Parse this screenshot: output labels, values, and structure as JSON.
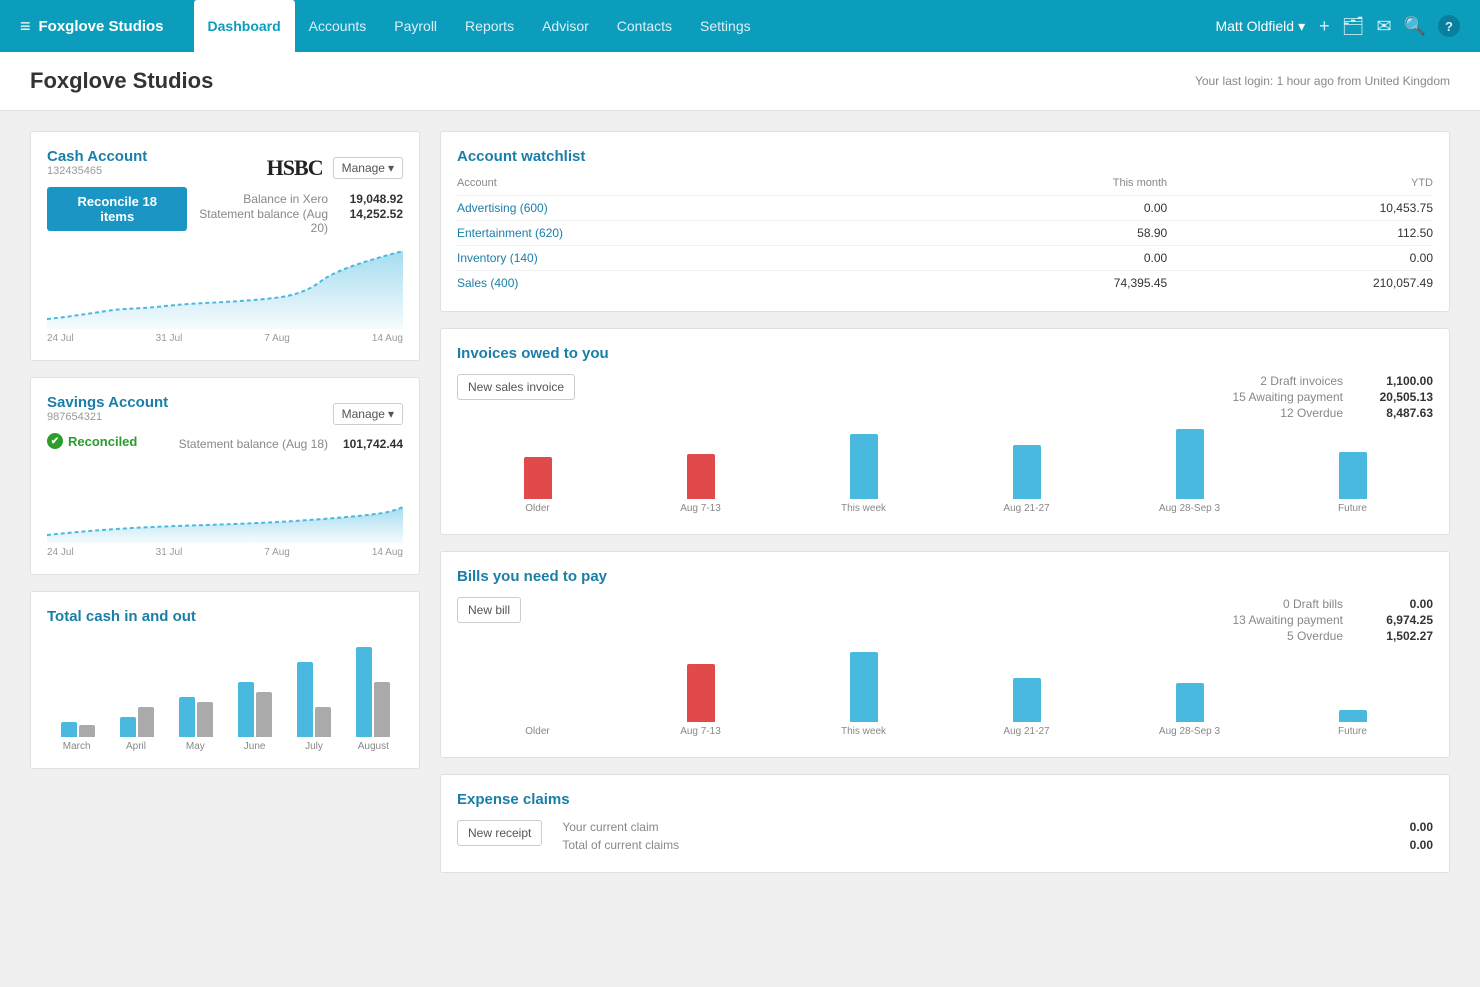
{
  "brand": {
    "icon": "≡",
    "name": "Foxglove Studios"
  },
  "nav": {
    "links": [
      {
        "label": "Dashboard",
        "active": true
      },
      {
        "label": "Accounts",
        "active": false
      },
      {
        "label": "Payroll",
        "active": false
      },
      {
        "label": "Reports",
        "active": false
      },
      {
        "label": "Advisor",
        "active": false
      },
      {
        "label": "Contacts",
        "active": false
      },
      {
        "label": "Settings",
        "active": false
      }
    ],
    "user": "Matt Oldfield",
    "icons": [
      "+",
      "📁",
      "✉",
      "🔍",
      "?"
    ]
  },
  "page": {
    "title": "Foxglove Studios",
    "last_login": "Your last login: 1 hour ago from United Kingdom"
  },
  "cash_account": {
    "name": "Cash Account",
    "number": "132435465",
    "logo": "HSBC",
    "manage_label": "Manage",
    "reconcile_label": "Reconcile 18 items",
    "balance_in_xero_label": "Balance in Xero",
    "balance_in_xero": "19,048.92",
    "statement_balance_label": "Statement balance (Aug 20)",
    "statement_balance": "14,252.52",
    "chart_labels": [
      "24 Jul",
      "31 Jul",
      "7 Aug",
      "14 Aug"
    ]
  },
  "savings_account": {
    "name": "Savings Account",
    "number": "987654321",
    "manage_label": "Manage",
    "reconciled_label": "Reconciled",
    "statement_balance_label": "Statement balance (Aug 18)",
    "statement_balance": "101,742.44",
    "chart_labels": [
      "24 Jul",
      "31 Jul",
      "7 Aug",
      "14 Aug"
    ]
  },
  "total_cash": {
    "title": "Total cash in and out",
    "chart_labels": [
      "March",
      "April",
      "May",
      "June",
      "July",
      "August"
    ],
    "blue_bars": [
      15,
      20,
      40,
      55,
      75,
      90
    ],
    "gray_bars": [
      12,
      30,
      35,
      45,
      30,
      55
    ]
  },
  "watchlist": {
    "title": "Account watchlist",
    "col_account": "Account",
    "col_this_month": "This month",
    "col_ytd": "YTD",
    "rows": [
      {
        "name": "Advertising (600)",
        "this_month": "0.00",
        "ytd": "10,453.75"
      },
      {
        "name": "Entertainment (620)",
        "this_month": "58.90",
        "ytd": "112.50"
      },
      {
        "name": "Inventory (140)",
        "this_month": "0.00",
        "ytd": "0.00"
      },
      {
        "name": "Sales (400)",
        "this_month": "74,395.45",
        "ytd": "210,057.49"
      }
    ]
  },
  "invoices": {
    "title": "Invoices owed to you",
    "new_button": "New sales invoice",
    "stats": [
      {
        "label": "2 Draft invoices",
        "value": "1,100.00"
      },
      {
        "label": "15 Awaiting payment",
        "value": "20,505.13"
      },
      {
        "label": "12 Overdue",
        "value": "8,487.63"
      }
    ],
    "bars": [
      {
        "label": "Older",
        "blue": 0,
        "red": 45
      },
      {
        "label": "Aug 7-13",
        "blue": 0,
        "red": 48
      },
      {
        "label": "This week",
        "blue": 70,
        "red": 0
      },
      {
        "label": "Aug 21-27",
        "blue": 58,
        "red": 0
      },
      {
        "label": "Aug 28-Sep 3",
        "blue": 75,
        "red": 0
      },
      {
        "label": "Future",
        "blue": 50,
        "red": 0
      }
    ]
  },
  "bills": {
    "title": "Bills you need to pay",
    "new_button": "New bill",
    "stats": [
      {
        "label": "0 Draft bills",
        "value": "0.00"
      },
      {
        "label": "13 Awaiting payment",
        "value": "6,974.25"
      },
      {
        "label": "5 Overdue",
        "value": "1,502.27"
      }
    ],
    "bars": [
      {
        "label": "Older",
        "blue": 0,
        "red": 0
      },
      {
        "label": "Aug 7-13",
        "blue": 0,
        "red": 60
      },
      {
        "label": "This week",
        "blue": 72,
        "red": 0
      },
      {
        "label": "Aug 21-27",
        "blue": 45,
        "red": 0
      },
      {
        "label": "Aug 28-Sep 3",
        "blue": 40,
        "red": 0
      },
      {
        "label": "Future",
        "blue": 12,
        "red": 0
      }
    ]
  },
  "expenses": {
    "title": "Expense claims",
    "new_button": "New receipt",
    "current_claim_label": "Your current claim",
    "current_claim_value": "0.00",
    "total_claims_label": "Total of current claims",
    "total_claims_value": "0.00"
  }
}
